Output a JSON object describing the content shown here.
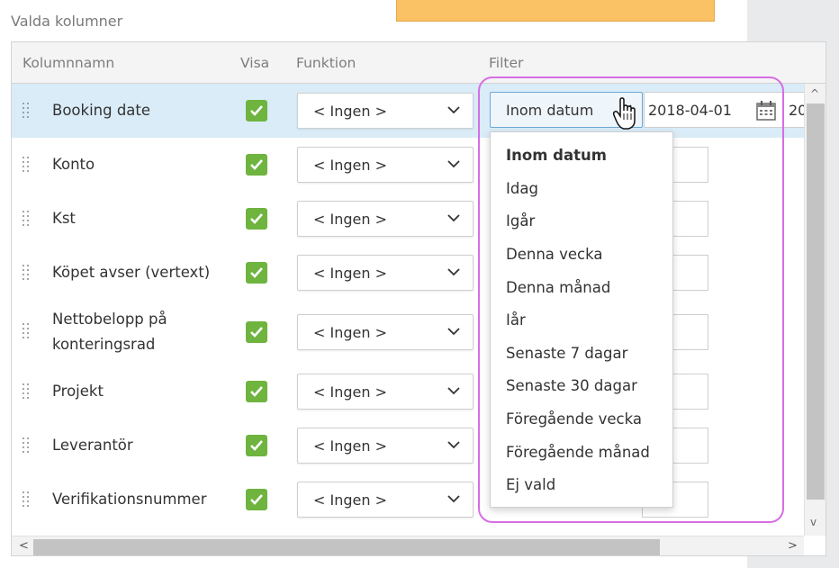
{
  "section_title": "Valda kolumner",
  "headers": {
    "name": "Kolumnnamn",
    "show": "Visa",
    "function": "Funktion",
    "filter": "Filter"
  },
  "rows": [
    {
      "name": "Booking date",
      "name2": "",
      "function": "< Ingen >",
      "checked": true
    },
    {
      "name": "Konto",
      "name2": "",
      "function": "< Ingen >",
      "checked": true
    },
    {
      "name": "Kst",
      "name2": "",
      "function": "< Ingen >",
      "checked": true
    },
    {
      "name": "Köpet avser (vertext)",
      "name2": "",
      "function": "< Ingen >",
      "checked": true
    },
    {
      "name": "Nettobelopp på",
      "name2": "konteringsrad",
      "function": "< Ingen >",
      "checked": true
    },
    {
      "name": "Projekt",
      "name2": "",
      "function": "< Ingen >",
      "checked": true
    },
    {
      "name": "Leverantör",
      "name2": "",
      "function": "< Ingen >",
      "checked": true
    },
    {
      "name": "Verifikationsnummer",
      "name2": "",
      "function": "< Ingen >",
      "checked": true
    }
  ],
  "filter": {
    "selected": "Inom datum",
    "date_from": "2018-04-01",
    "date_to_partial": "20"
  },
  "dropdown_options": [
    "Inom datum",
    "Idag",
    "Igår",
    "Denna vecka",
    "Denna månad",
    "Iår",
    "Senaste 7 dagar",
    "Senaste 30 dagar",
    "Föregående vecka",
    "Föregående månad",
    "Ej vald"
  ],
  "colors": {
    "checkbox": "#6eb43f",
    "selected_row": "#d9ecf8",
    "highlight": "#d66ee3",
    "orange": "#fbc165"
  }
}
